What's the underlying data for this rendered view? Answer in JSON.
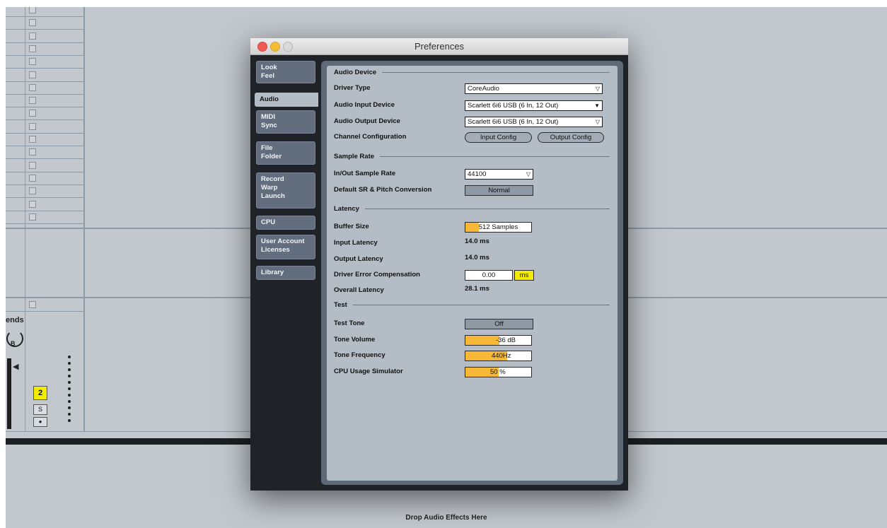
{
  "window": {
    "title": "Preferences"
  },
  "tabs": [
    {
      "lines": [
        "Look",
        "Feel"
      ]
    },
    {
      "lines": [
        "Audio"
      ]
    },
    {
      "lines": [
        "MIDI",
        "Sync"
      ]
    },
    {
      "lines": [
        "File",
        "Folder"
      ]
    },
    {
      "lines": [
        "Record",
        "Warp",
        "Launch"
      ]
    },
    {
      "lines": [
        "CPU"
      ]
    },
    {
      "lines": [
        "User Account",
        "Licenses"
      ]
    },
    {
      "lines": [
        "Library"
      ]
    }
  ],
  "active_tab": "Audio",
  "audio_device": {
    "section_title": "Audio Device",
    "driver_type_label": "Driver Type",
    "driver_type_value": "CoreAudio",
    "input_device_label": "Audio Input Device",
    "input_device_value": "Scarlett 6i6 USB (6 In, 12 Out)",
    "output_device_label": "Audio Output Device",
    "output_device_value": "Scarlett 6i6 USB (6 In, 12 Out)",
    "channel_config_label": "Channel Configuration",
    "input_config_button": "Input Config",
    "output_config_button": "Output Config"
  },
  "sample_rate": {
    "section_title": "Sample Rate",
    "inout_label": "In/Out Sample Rate",
    "inout_value": "44100",
    "default_sr_label": "Default SR & Pitch Conversion",
    "default_sr_value": "Normal"
  },
  "latency": {
    "section_title": "Latency",
    "buffer_size_label": "Buffer Size",
    "buffer_size_value": "512 Samples",
    "buffer_size_fill_fraction": 0.2,
    "input_latency_label": "Input Latency",
    "input_latency_value": "14.0 ms",
    "output_latency_label": "Output Latency",
    "output_latency_value": "14.0 ms",
    "driver_error_label": "Driver Error Compensation",
    "driver_error_value": "0.00",
    "driver_error_unit": "ms",
    "overall_latency_label": "Overall Latency",
    "overall_latency_value": "28.1 ms"
  },
  "test": {
    "section_title": "Test",
    "test_tone_label": "Test Tone",
    "test_tone_value": "Off",
    "tone_volume_label": "Tone Volume",
    "tone_volume_value": "-36",
    "tone_volume_unit": "dB",
    "tone_volume_fill_fraction": 0.52,
    "tone_frequency_label": "Tone Frequency",
    "tone_frequency_value": "440",
    "tone_frequency_unit": "Hz",
    "tone_frequency_fill_fraction": 0.63,
    "cpu_sim_label": "CPU Usage Simulator",
    "cpu_sim_value": "50",
    "cpu_sim_unit": "%",
    "cpu_sim_fill_fraction": 0.5
  },
  "background": {
    "sends_label": "ends",
    "sends_knob_letter": "B",
    "track_number": "2",
    "solo_label": "S",
    "arm_label": "●",
    "drop_zone_text": "Drop Audio Effects Here"
  },
  "colors": {
    "accent_orange": "#f6b836",
    "accent_yellow": "#f3ec00",
    "panel_gray": "#b4bcc5",
    "window_dark": "#1f2226",
    "tab_blue_gray": "#626d7d"
  }
}
